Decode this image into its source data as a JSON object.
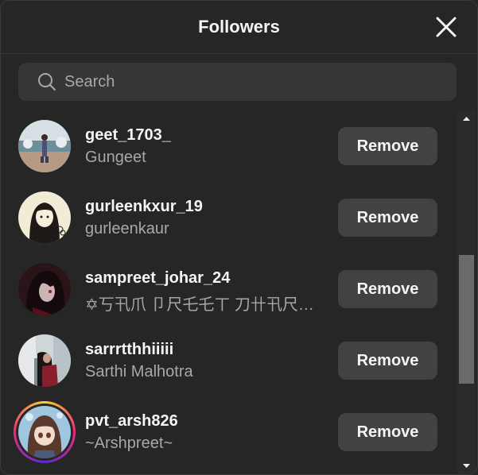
{
  "dialog": {
    "title": "Followers",
    "close_icon": "close-icon"
  },
  "search": {
    "placeholder": "Search",
    "value": "",
    "icon": "search-icon"
  },
  "followers": [
    {
      "username": "geet_1703_",
      "full_name": "Gungeet",
      "action": "Remove",
      "story_ring": false
    },
    {
      "username": "gurleenkxur_19",
      "full_name": "gurleenkaur",
      "action": "Remove",
      "story_ring": false
    },
    {
      "username": "sampreet_johar_24",
      "full_name": "✡丂卂爪 卩尺乇乇ㄒ 刀卄卂尺…",
      "action": "Remove",
      "story_ring": false
    },
    {
      "username": "sarrrtthhiiiii",
      "full_name": "Sarthi Malhotra",
      "action": "Remove",
      "story_ring": false
    },
    {
      "username": "pvt_arsh826",
      "full_name": "~Arshpreet~",
      "action": "Remove",
      "story_ring": true
    }
  ],
  "colors": {
    "background": "#262626",
    "button": "#424242",
    "secondary_text": "#a8a8a8"
  }
}
